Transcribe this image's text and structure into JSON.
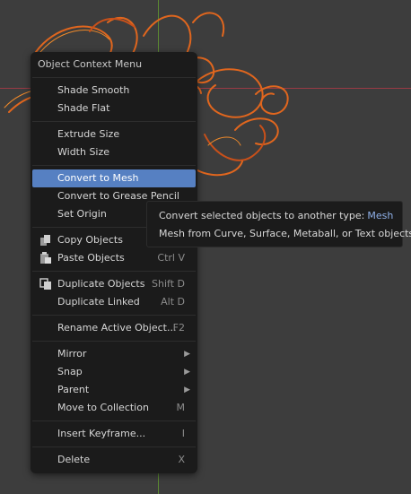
{
  "colors": {
    "viewport_bg": "#3d3d3d",
    "menu_bg": "#1b1b1b",
    "highlight": "#5680c2",
    "curve_orange": "#e0661e",
    "axis_red": "#9a3a44",
    "axis_green": "#5c8a32"
  },
  "menu": {
    "title": "Object Context Menu",
    "items": {
      "shade_smooth": {
        "label": "Shade Smooth"
      },
      "shade_flat": {
        "label": "Shade Flat"
      },
      "extrude_size": {
        "label": "Extrude Size"
      },
      "width_size": {
        "label": "Width Size"
      },
      "convert_to_mesh": {
        "label": "Convert to Mesh"
      },
      "convert_to_grease_pencil": {
        "label": "Convert to Grease Pencil"
      },
      "set_origin": {
        "label": "Set Origin"
      },
      "copy_objects": {
        "label": "Copy Objects",
        "icon": "copy-icon"
      },
      "paste_objects": {
        "label": "Paste Objects",
        "shortcut": "Ctrl V",
        "icon": "paste-icon"
      },
      "duplicate_objects": {
        "label": "Duplicate Objects",
        "shortcut": "Shift D",
        "icon": "duplicate-icon"
      },
      "duplicate_linked": {
        "label": "Duplicate Linked",
        "shortcut": "Alt D"
      },
      "rename_active": {
        "label": "Rename Active Object...",
        "shortcut": "F2"
      },
      "mirror": {
        "label": "Mirror",
        "icon": "submenu-arrow-icon"
      },
      "snap": {
        "label": "Snap",
        "icon": "submenu-arrow-icon"
      },
      "parent": {
        "label": "Parent",
        "icon": "submenu-arrow-icon"
      },
      "move_to_collection": {
        "label": "Move to Collection",
        "shortcut": "M"
      },
      "insert_keyframe": {
        "label": "Insert Keyframe...",
        "shortcut": "I"
      },
      "delete": {
        "label": "Delete",
        "shortcut": "X"
      }
    }
  },
  "tooltip": {
    "line1_text": "Convert selected objects to another type:",
    "line1_value": "Mesh",
    "line2": "Mesh from Curve, Surface, Metaball, or Text objects"
  }
}
